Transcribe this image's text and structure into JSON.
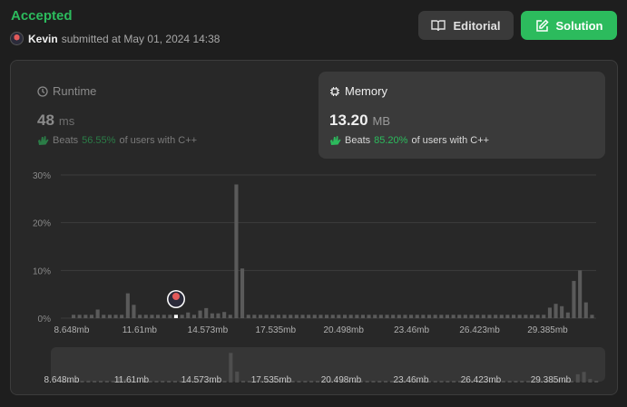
{
  "header": {
    "status": "Accepted",
    "username": "Kevin",
    "submitted_text": "submitted at May 01, 2024 14:38",
    "editorial_label": "Editorial",
    "solution_label": "Solution"
  },
  "runtime": {
    "title": "Runtime",
    "value": "48",
    "unit": "ms",
    "beats_label": "Beats",
    "beats_pct": "56.55%",
    "beats_suffix": "of users with C++"
  },
  "memory": {
    "title": "Memory",
    "value": "13.20",
    "unit": "MB",
    "beats_label": "Beats",
    "beats_pct": "85.20%",
    "beats_suffix": "of users with C++"
  },
  "colors": {
    "accent": "#2cbb5d",
    "bar": "#5a5a5a",
    "highlight_bar": "#ffffff"
  },
  "chart_data": {
    "type": "bar",
    "title": "",
    "xlabel": "",
    "ylabel": "",
    "ylim": [
      0,
      30
    ],
    "y_ticks": [
      "0%",
      "10%",
      "20%",
      "30%"
    ],
    "x_tick_labels": [
      "8.648mb",
      "11.61mb",
      "14.573mb",
      "17.535mb",
      "20.498mb",
      "23.46mb",
      "26.423mb",
      "29.385mb"
    ],
    "x_range": [
      8.648,
      31.5
    ],
    "grid": true,
    "user_value_mb": 13.2,
    "series": [
      {
        "values": [
          0.7,
          0.7,
          0.7,
          0.7,
          1.8,
          0.7,
          0.7,
          0.7,
          0.7,
          5.2,
          2.8,
          0.7,
          0.7,
          0.7,
          0.7,
          0.7,
          0.7,
          0.7,
          0.7,
          1.2,
          0.7,
          1.6,
          2.1,
          1.0,
          1.0,
          1.3,
          0.7,
          28.0,
          10.4,
          0.7,
          0.7,
          0.7,
          0.7,
          0.7,
          0.7,
          0.7,
          0.7,
          0.7,
          0.7,
          0.7,
          0.7,
          0.7,
          0.7,
          0.7,
          0.7,
          0.7,
          0.7,
          0.7,
          0.7,
          0.7,
          0.7,
          0.7,
          0.7,
          0.7,
          0.7,
          0.7,
          0.7,
          0.7,
          0.7,
          0.7,
          0.7,
          0.7,
          0.7,
          0.7,
          0.7,
          0.7,
          0.7,
          0.7,
          0.7,
          0.7,
          0.7,
          0.7,
          0.7,
          0.7,
          0.7,
          0.7,
          0.7,
          0.7,
          0.7,
          2.2,
          3.0,
          2.5,
          1.2,
          7.8,
          10.0,
          3.3,
          0.7
        ],
        "highlight_index": 17
      }
    ]
  }
}
